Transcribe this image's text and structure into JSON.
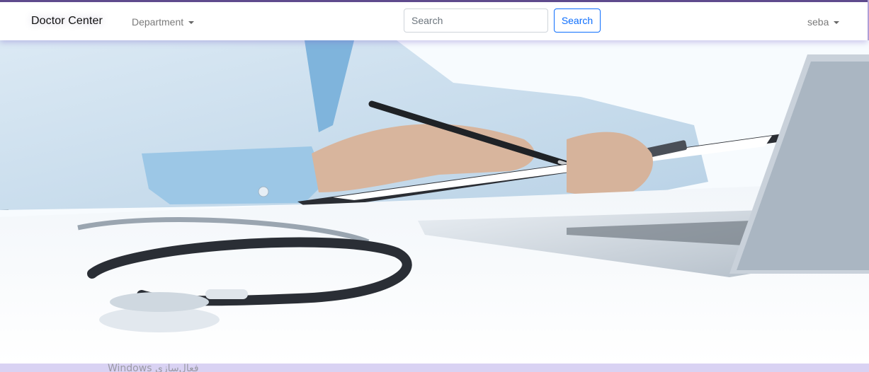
{
  "navbar": {
    "brand": "Doctor Center",
    "department_label": "Department",
    "search_placeholder": "Search",
    "search_button": "Search",
    "user_name": "seba"
  },
  "hero": {
    "image_description": ""
  },
  "watermark": "Windows فعال‌سازی",
  "colors": {
    "frame": "#5e4a8a",
    "accent": "#0d6efd",
    "bottom_strip": "#d9d2f3"
  }
}
